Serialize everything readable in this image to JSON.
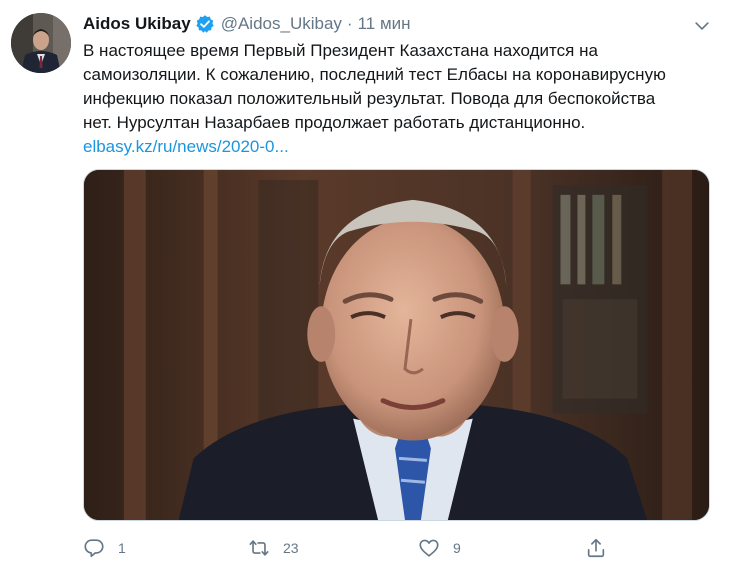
{
  "author": {
    "name": "Aidos Ukibay",
    "handle": "@Aidos_Ukibay",
    "separator": "·",
    "time": "11 мин"
  },
  "tweet": {
    "lines": [
      "В настоящее время Первый Президент Казахстана находится на",
      "самоизоляции. К сожалению, последний тест Елбасы на коронавирусную",
      "инфекцию показал положительный результат. Повода для беспокойства",
      "нет. Нурсултан Назарбаев продолжает работать дистанционно."
    ],
    "link": "elbasy.kz/ru/news/2020-0..."
  },
  "actions": {
    "reply_count": "1",
    "retweet_count": "23",
    "like_count": "9"
  },
  "icons": {
    "verified": "verified-badge-icon",
    "more": "chevron-down-icon",
    "reply": "reply-icon",
    "retweet": "retweet-icon",
    "like": "heart-icon",
    "share": "share-icon"
  },
  "colors": {
    "text": "#14171a",
    "secondary": "#657786",
    "link": "#1b95e0",
    "verified": "#1da1f2"
  }
}
